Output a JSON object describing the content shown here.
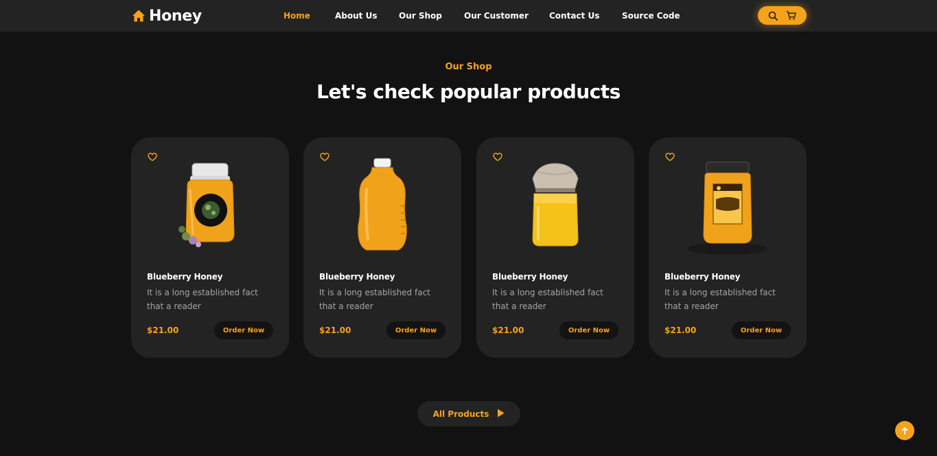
{
  "brand": {
    "name": "Honey",
    "accent": "#f7a21b",
    "background": "#121212",
    "card": "#232323"
  },
  "nav": {
    "links": [
      {
        "label": "Home",
        "active": true
      },
      {
        "label": "About Us"
      },
      {
        "label": "Our Shop"
      },
      {
        "label": "Our Customer"
      },
      {
        "label": "Contact Us"
      },
      {
        "label": "Source Code"
      }
    ],
    "icons": [
      "search-icon",
      "cart-icon"
    ]
  },
  "section": {
    "eyebrow": "Our Shop",
    "title": "Let's check popular products"
  },
  "products": [
    {
      "name": "Blueberry Honey",
      "description": "It is a long established fact that a reader",
      "price": "$21.00",
      "cta": "Order Now",
      "image": "honey-jar-label-icon"
    },
    {
      "name": "Blueberry Honey",
      "description": "It is a long established fact that a reader",
      "price": "$21.00",
      "cta": "Order Now",
      "image": "honey-bottle-icon"
    },
    {
      "name": "Blueberry Honey",
      "description": "It is a long established fact that a reader",
      "price": "$21.00",
      "cta": "Order Now",
      "image": "honey-jar-cloth-icon"
    },
    {
      "name": "Blueberry Honey",
      "description": "It is a long established fact that a reader",
      "price": "$21.00",
      "cta": "Order Now",
      "image": "honey-jar-bee-label-icon"
    }
  ],
  "footer": {
    "all_products_label": "All Products"
  }
}
